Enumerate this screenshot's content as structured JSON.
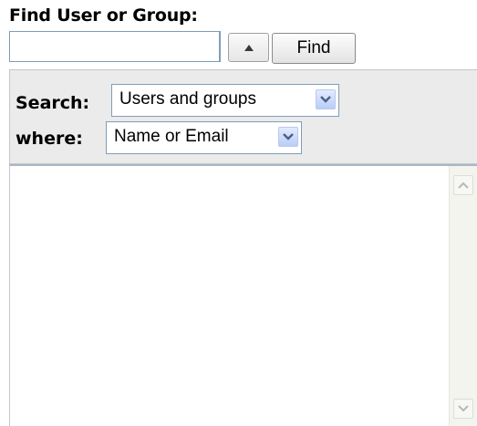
{
  "header": {
    "title": "Find User or Group:"
  },
  "find": {
    "input_value": "",
    "button_label": "Find"
  },
  "search": {
    "label": "Search:",
    "selected": "Users and groups"
  },
  "where": {
    "label": "where:",
    "selected": "Name or Email"
  },
  "results": {
    "items": []
  },
  "icons": {
    "up": "triangle-up-icon",
    "dropdown": "chevron-down-icon",
    "scroll_up": "scroll-up-icon",
    "scroll_down": "scroll-down-icon"
  },
  "colors": {
    "panel_bg": "#ebebeb",
    "field_border": "#7f9db9",
    "dropdown_arrow": "#4d6185"
  }
}
